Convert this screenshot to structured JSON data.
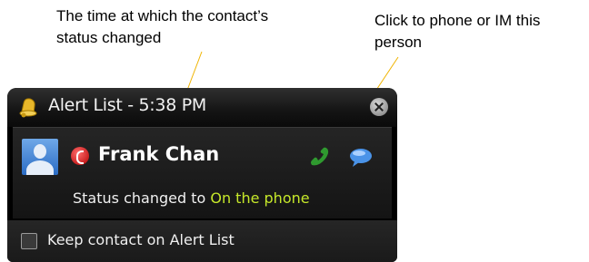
{
  "annotations": {
    "time_changed": "The time at which the contact’s status changed",
    "phone_im": "Click to phone or IM this person"
  },
  "window": {
    "title": "Alert List - 5:38 PM"
  },
  "contact": {
    "name": "Frank Chan",
    "status_prefix": "Status changed to",
    "status_value": "On the phone"
  },
  "footer": {
    "keep_label": "Keep contact on Alert List",
    "keep_checked": false
  },
  "icons": {
    "title": "bell-icon",
    "close": "close-icon",
    "avatar": "avatar",
    "presence": "presence-busy-icon",
    "phone": "phone-icon",
    "im": "chat-bubble-icon"
  },
  "colors": {
    "status_value": "#c6e82a",
    "leader_line": "#f0b400",
    "window_bg": "#000000"
  }
}
